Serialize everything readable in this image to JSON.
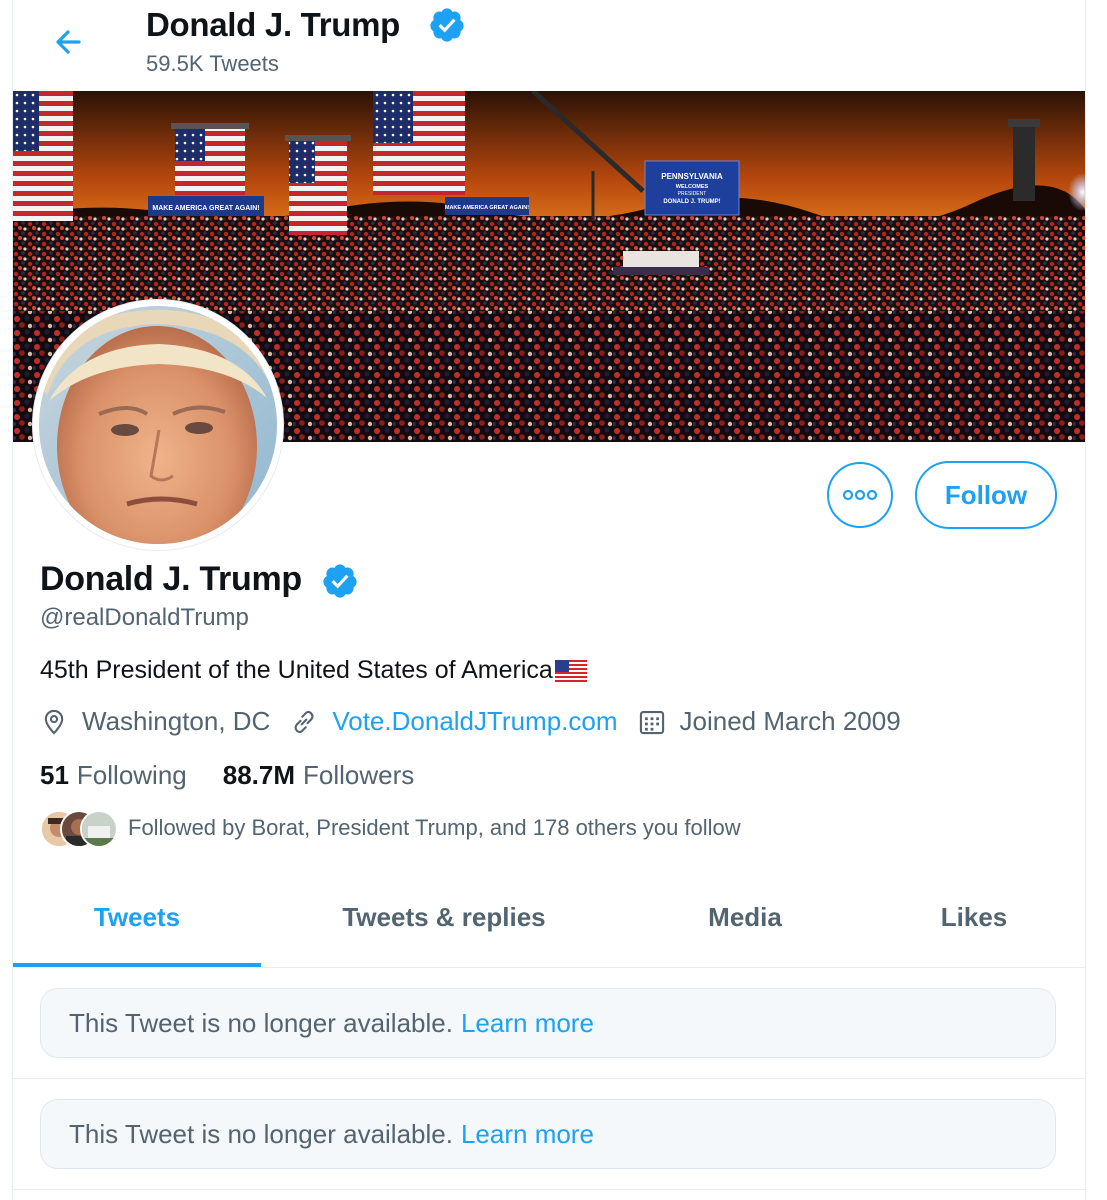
{
  "colors": {
    "accent": "#1da1f2",
    "muted": "#536471",
    "text": "#0f1419",
    "border": "#e6ecf0"
  },
  "header": {
    "name": "Donald J. Trump",
    "tweet_count": "59.5K Tweets",
    "back_icon": "back-arrow-icon",
    "verified_icon": "verified-badge-icon"
  },
  "banner": {
    "description": "rally-crowd-sunset-photo",
    "sign_main": [
      "PENNSYLVANIA",
      "WELCOMES",
      "PRESIDENT",
      "DONALD J. TRUMP!"
    ],
    "sign_small_1": "MAKE AMERICA GREAT AGAIN!",
    "sign_small_2": "MAKE AMERICA GREAT AGAIN!"
  },
  "actions": {
    "more_icon": "more-options-icon",
    "follow_label": "Follow"
  },
  "profile": {
    "name": "Donald J. Trump",
    "handle": "@realDonaldTrump",
    "bio": "45th President of the United States of America",
    "bio_emoji": "us-flag-emoji",
    "location": "Washington, DC",
    "website": "Vote.DonaldJTrump.com",
    "joined": "Joined March 2009",
    "following_count": "51",
    "following_label": "Following",
    "followers_count": "88.7M",
    "followers_label": "Followers",
    "followed_by": "Followed by Borat, President Trump, and 178 others you follow"
  },
  "tabs": [
    {
      "label": "Tweets",
      "active": true
    },
    {
      "label": "Tweets & replies",
      "active": false
    },
    {
      "label": "Media",
      "active": false
    },
    {
      "label": "Likes",
      "active": false
    }
  ],
  "tweets": [
    {
      "text": "This Tweet is no longer available.",
      "link": "Learn more"
    },
    {
      "text": "This Tweet is no longer available.",
      "link": "Learn more"
    }
  ]
}
